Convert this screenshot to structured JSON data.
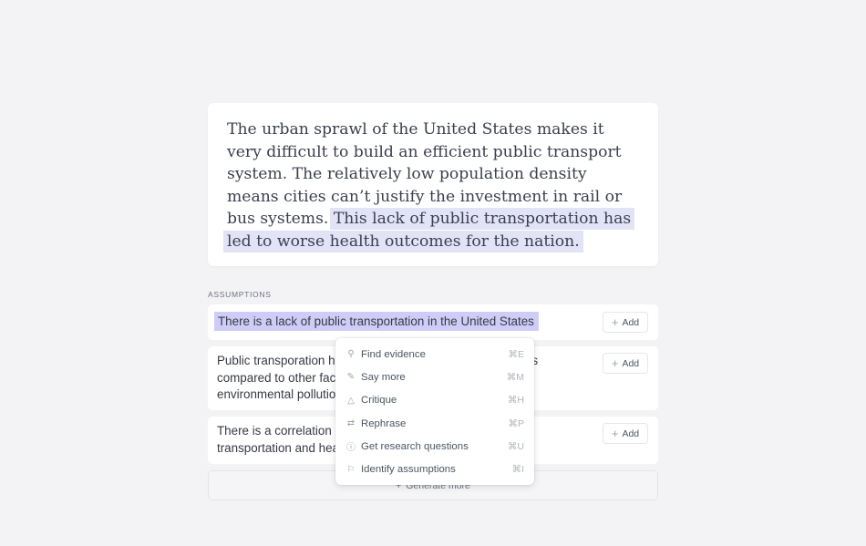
{
  "essay": {
    "plain": "The urban sprawl of the United States makes it very difficult to build an efficient public transport system. The relatively low population density means cities can’t justify the investment in rail or bus systems.",
    "highlighted": "This lack of public transportation has led to worse health outcomes for the nation."
  },
  "assumptions": {
    "label": "ASSUMPTIONS",
    "items": [
      {
        "text": "There is a lack of public transportation in the United States",
        "add_label": "Add"
      },
      {
        "text": "Public transporation has a large impact on health outcomes compared to other factors such as diet, exercise, and environmental pollution.",
        "add_label": "Add"
      },
      {
        "text": "There is a correlation between public transportation and health outcomes.",
        "add_label": "Add"
      }
    ],
    "generate_more": "Generate more"
  },
  "menu": {
    "items": [
      {
        "icon": "search-icon",
        "label": "Find evidence",
        "shortcut": "⌘E"
      },
      {
        "icon": "pencil-icon",
        "label": "Say more",
        "shortcut": "⌘M"
      },
      {
        "icon": "warning-icon",
        "label": "Critique",
        "shortcut": "⌘H"
      },
      {
        "icon": "shuffle-icon",
        "label": "Rephrase",
        "shortcut": "⌘P"
      },
      {
        "icon": "question-circle-icon",
        "label": "Get research questions",
        "shortcut": "⌘U"
      },
      {
        "icon": "flag-icon",
        "label": "Identify assumptions",
        "shortcut": "⌘I"
      }
    ]
  },
  "colors": {
    "selection_highlight": "#cfcdf8",
    "essay_highlight": "#e2e3f6",
    "background": "#f3f3f6"
  }
}
